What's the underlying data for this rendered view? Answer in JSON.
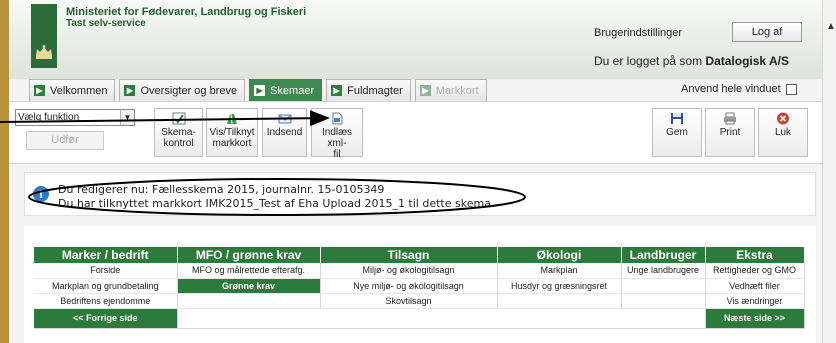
{
  "header": {
    "ministry": "Ministeriet for Fødevarer, Landbrug og Fiskeri",
    "subtitle": "Tast selv-service",
    "user_settings": "Brugerindstillinger",
    "logout": "Log af",
    "logged_in_prefix": "Du er logget på som",
    "logged_in_user": "Datalogisk A/S"
  },
  "tabs": [
    {
      "label": "Velkommen",
      "state": "normal"
    },
    {
      "label": "Oversigter og breve",
      "state": "normal"
    },
    {
      "label": "Skemaer",
      "state": "active"
    },
    {
      "label": "Fuldmagter",
      "state": "normal"
    },
    {
      "label": "Markkort",
      "state": "disabled"
    }
  ],
  "full_window_label": "Anvend hele vinduet",
  "toolbar": {
    "select_value": "Vælg funktion",
    "run_label": "Udfør",
    "buttons": {
      "skemakontrol": [
        "Skema-",
        "kontrol"
      ],
      "markkort": [
        "Vis/Tilknyt",
        "markkort"
      ],
      "indsend": [
        "Indsend"
      ],
      "xml": [
        "Indlæs xml-",
        "fil"
      ],
      "gem": [
        "Gem"
      ],
      "print": [
        "Print"
      ],
      "luk": [
        "Luk"
      ]
    }
  },
  "info": {
    "line1": "Du redigerer nu: Fællesskema 2015, journalnr. 15-0105349",
    "line2": "Du har tilknyttet markkort IMK2015_Test af Eha Upload 2015_1 til dette skema."
  },
  "nav": {
    "headers": [
      "Marker / bedrift",
      "MFO / grønne krav",
      "Tilsagn",
      "Økologi",
      "Landbruger",
      "Ekstra"
    ],
    "rows": [
      [
        "Forside",
        "MFO og målrettede efterafg.",
        "Miljø- og økologitilsagn",
        "Markplan",
        "Unge landbrugere",
        "Rettigheder og GMO"
      ],
      [
        "Markplan og grundbetaling",
        "Grønne krav",
        "Nye miljø- og økologitilsagn",
        "Husdyr og græsningsret",
        "",
        "Vedhæft filer"
      ],
      [
        "Bedriftens ejendomme",
        "",
        "Skovtilsagn",
        "",
        "",
        "Vis ændringer"
      ]
    ],
    "selected": "Grønne krav",
    "prev": "<< Forrige side",
    "next": "Næste side >>"
  },
  "colors": {
    "ministry_green": "#1f5f2f",
    "nav_green": "#2c7a3c",
    "active_tab": "#3e8a4e",
    "left_strip": "#b9913a",
    "info_icon": "#2a7ec8",
    "close_red": "#d93a2b"
  },
  "icons": [
    "crown-logo",
    "check-icon",
    "map-icon",
    "send-icon",
    "xml-file-icon",
    "save-icon",
    "print-icon",
    "close-icon",
    "info-icon"
  ]
}
